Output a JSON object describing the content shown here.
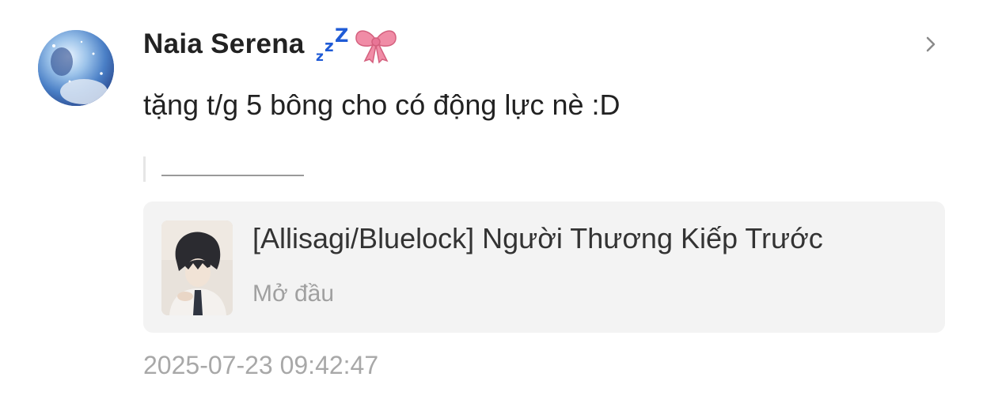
{
  "user": {
    "name": "Naia Serena",
    "emoji_icons": [
      "zzz-icon",
      "ribbon-bow-icon"
    ]
  },
  "comment": {
    "text": "tặng t/g 5 bông cho có động lực nè :D"
  },
  "story": {
    "title": "[Allisagi/Bluelock] Người Thương Kiếp Trước",
    "chapter": "Mở đầu"
  },
  "timestamp": "2025-07-23 09:42:47",
  "colors": {
    "zzz": "#1f5bd6",
    "bow": "#f08ca6",
    "card_bg": "#f3f3f3",
    "meta_text": "#a8a8a8"
  }
}
